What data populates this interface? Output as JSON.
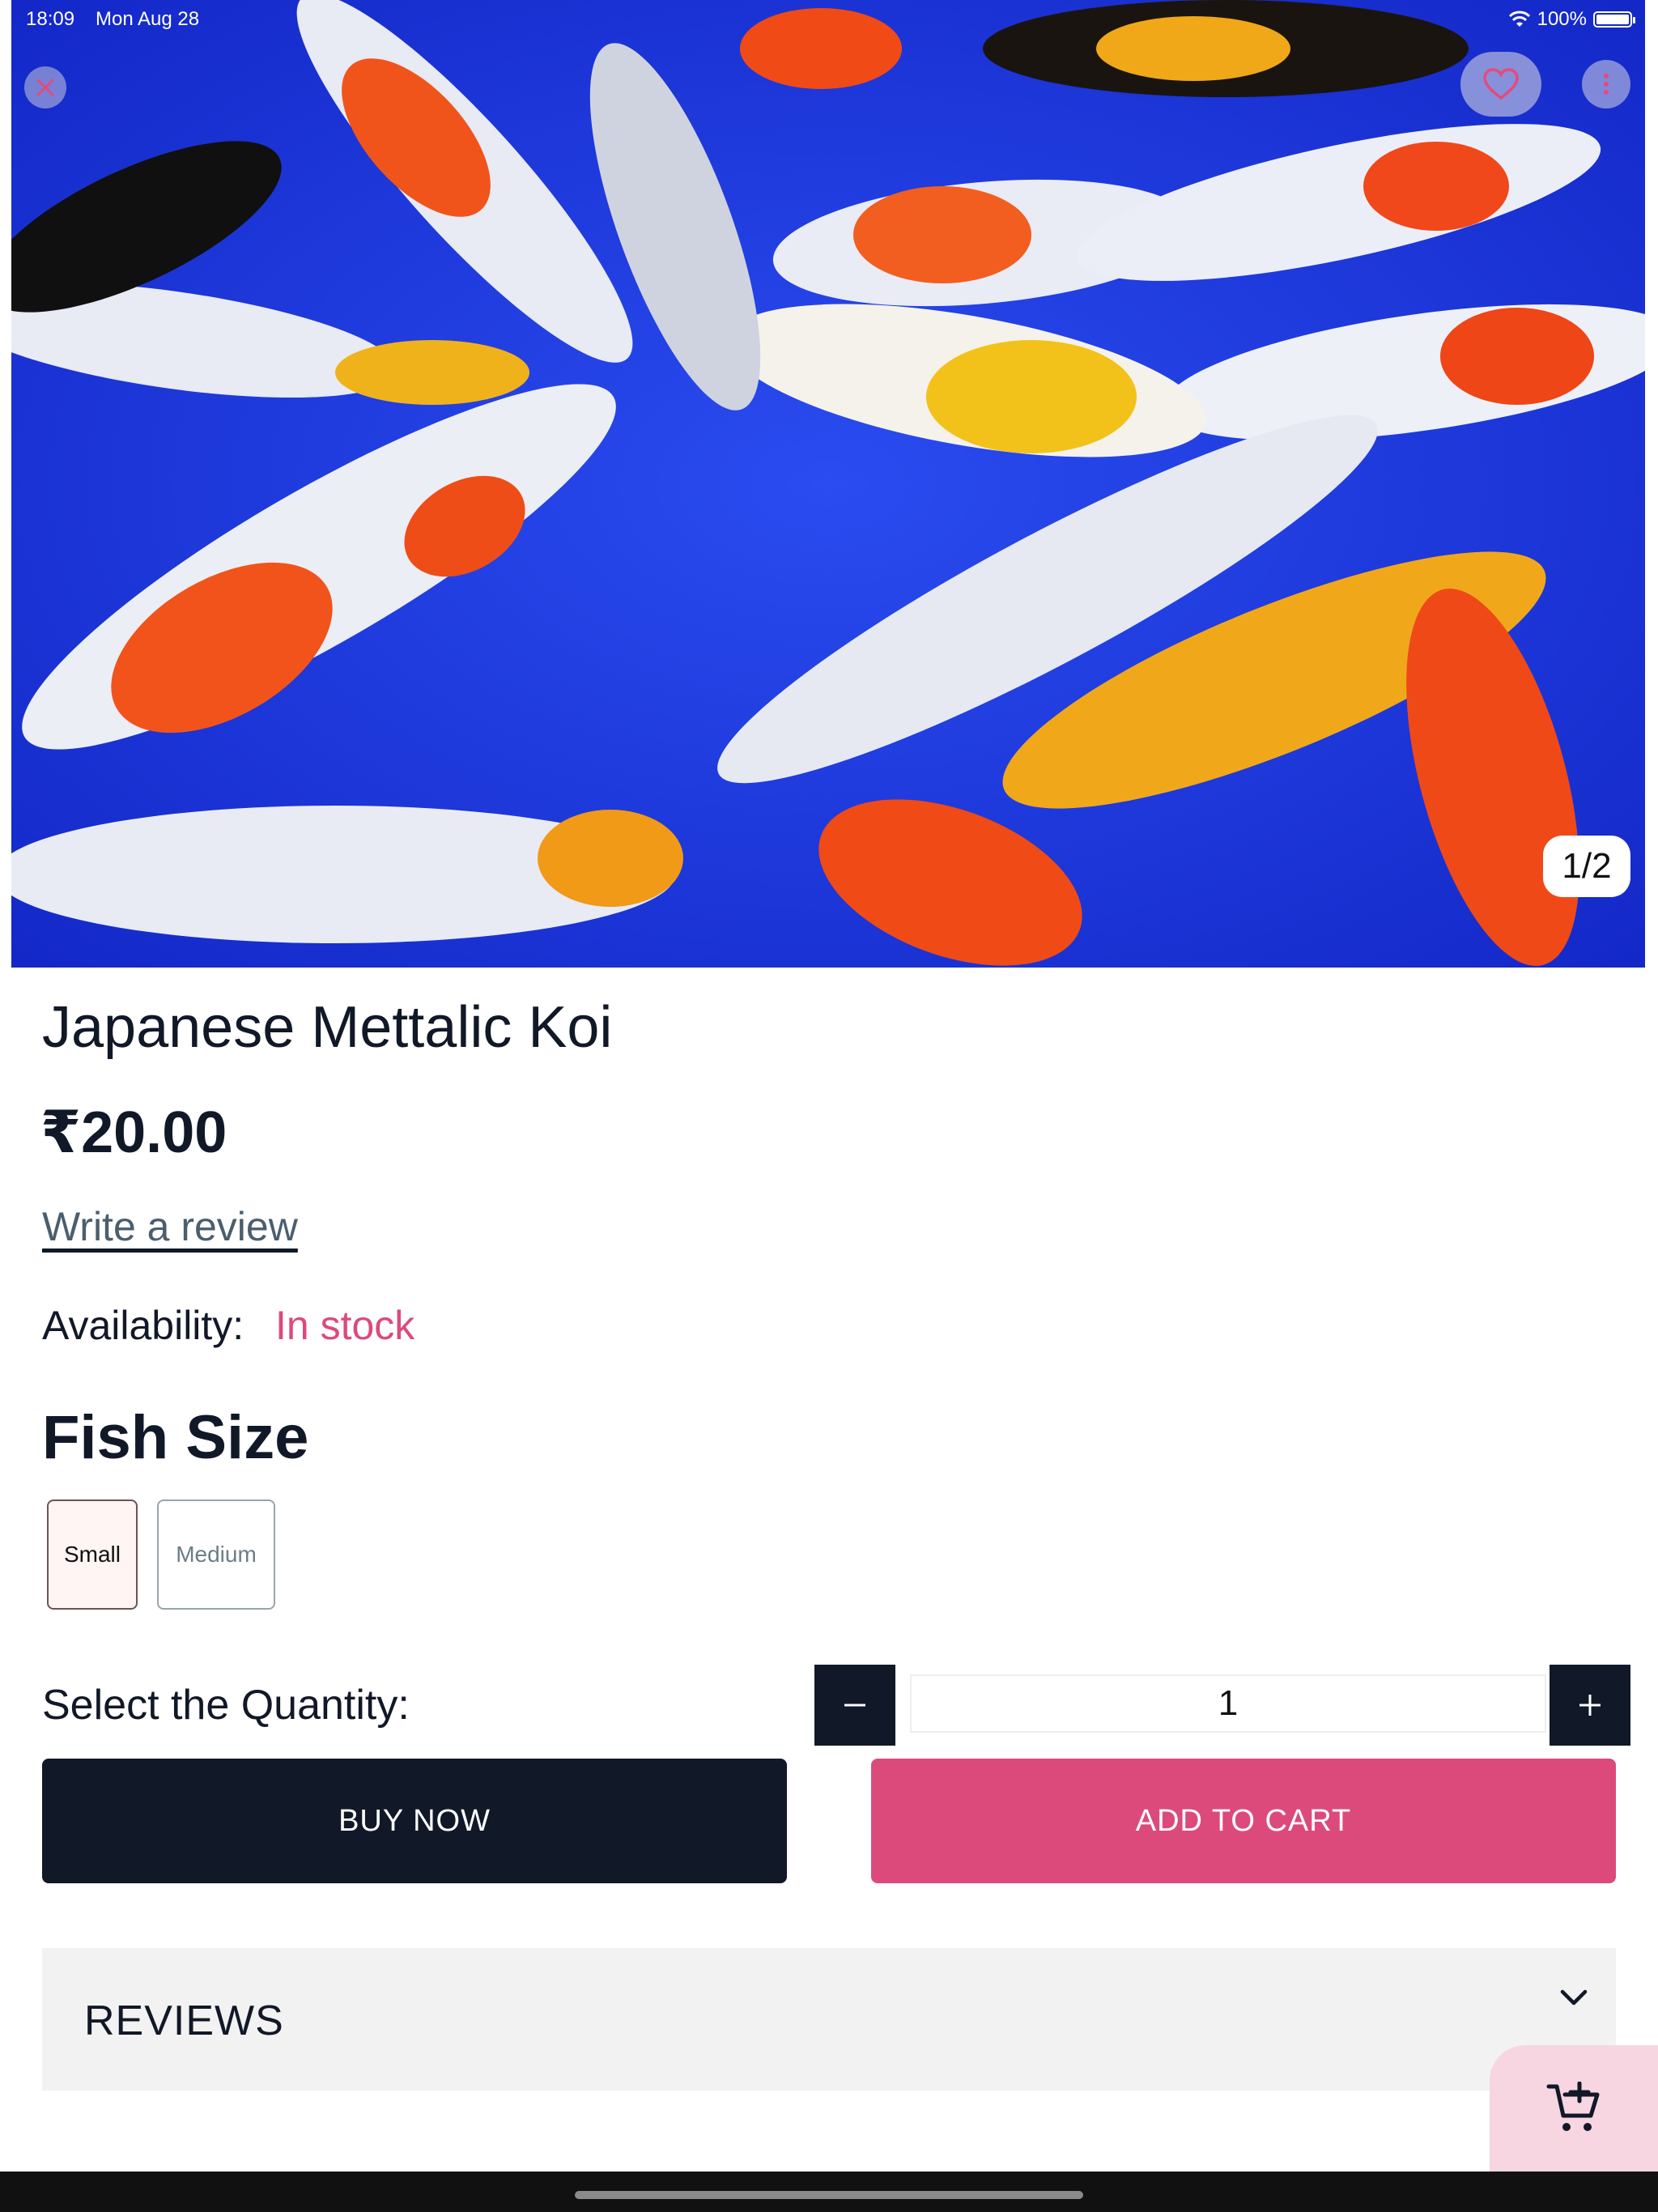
{
  "status_bar": {
    "time": "18:09",
    "date": "Mon Aug 28",
    "battery": "100%",
    "icons": [
      "wifi-icon",
      "battery-icon"
    ]
  },
  "gallery": {
    "counter": "1/2",
    "actions": [
      "close-icon",
      "heart-icon",
      "more-vertical-icon"
    ]
  },
  "product": {
    "title": "Japanese Mettalic Koi",
    "price": "₹20.00",
    "review_link": "Write a review",
    "availability_label": "Availability:",
    "availability_value": "In stock"
  },
  "size": {
    "heading": "Fish Size",
    "options": [
      "Small",
      "Medium"
    ],
    "selected": "Small"
  },
  "quantity": {
    "label": "Select the Quantity:",
    "value": "1",
    "minus": "−",
    "plus": "+"
  },
  "actions": {
    "buy_now": "BUY NOW",
    "add_to_cart": "ADD TO CART"
  },
  "reviews": {
    "label": "REVIEWS"
  },
  "colors": {
    "accent_pink": "#dc4a7b",
    "dark": "#111827",
    "fab_bg": "#f7d5e1",
    "reviews_bg": "#f2f2f2"
  }
}
